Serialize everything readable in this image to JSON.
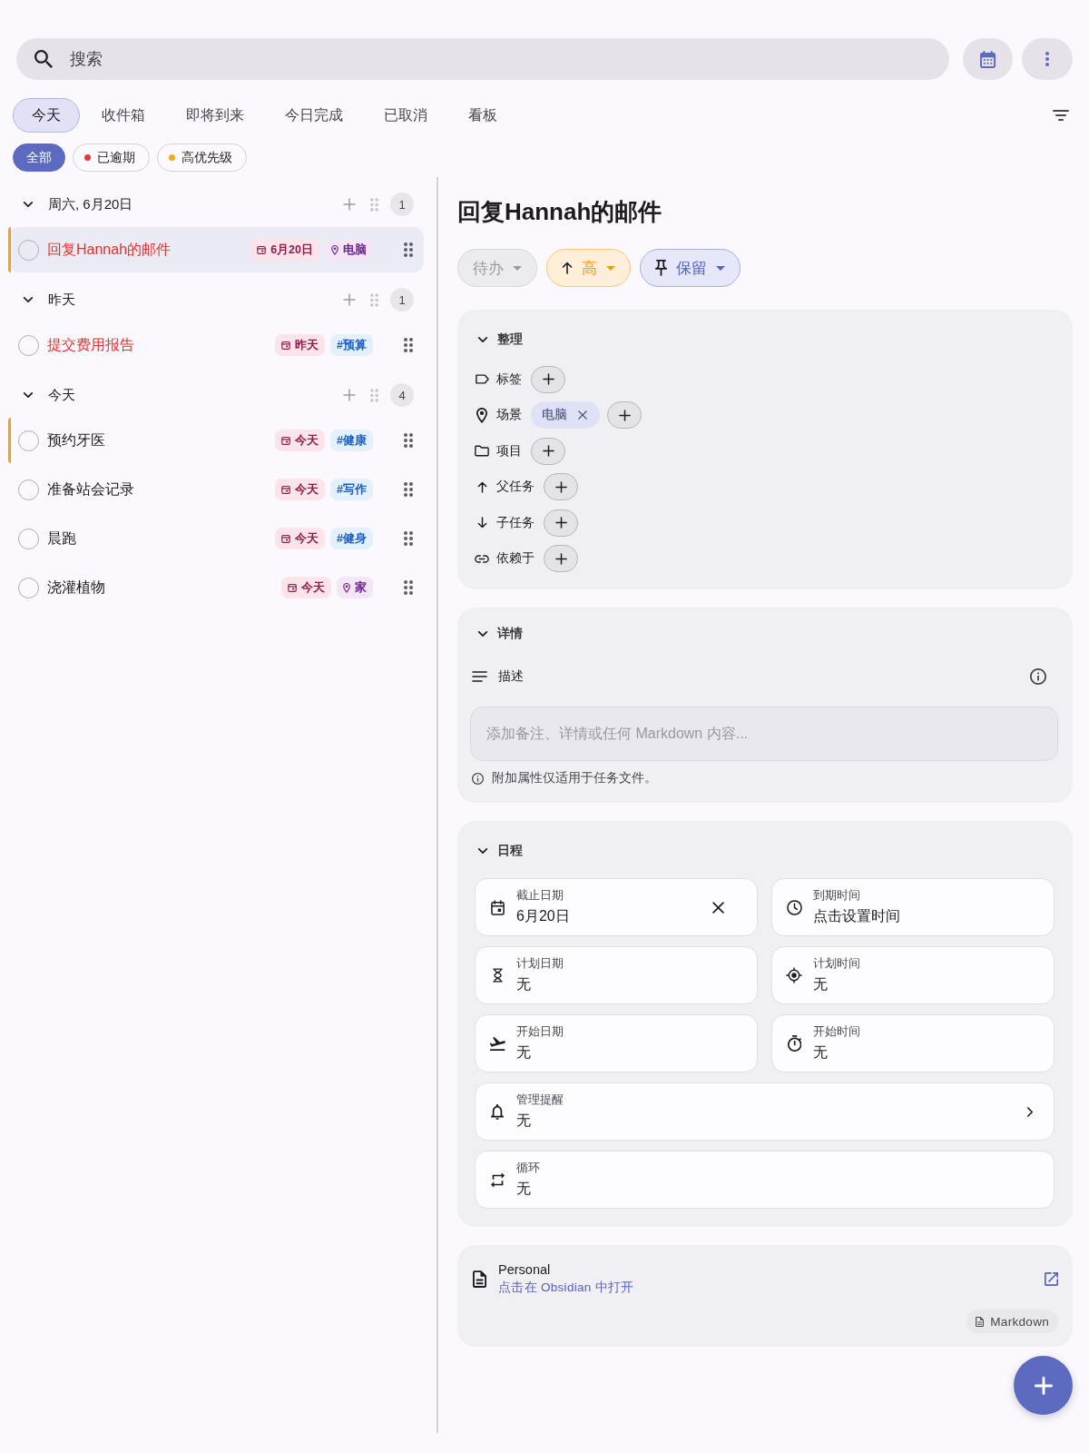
{
  "search": {
    "placeholder": "搜索"
  },
  "tabs": [
    {
      "label": "今天",
      "selected": true
    },
    {
      "label": "收件箱",
      "selected": false
    },
    {
      "label": "即将到来",
      "selected": false
    },
    {
      "label": "今日完成",
      "selected": false
    },
    {
      "label": "已取消",
      "selected": false
    },
    {
      "label": "看板",
      "selected": false
    }
  ],
  "filters": [
    {
      "label": "全部",
      "selected": true
    },
    {
      "label": "已逾期",
      "selected": false,
      "color": "#e53935"
    },
    {
      "label": "高优先级",
      "selected": false,
      "color": "#f9a825"
    }
  ],
  "groups": [
    {
      "title": "周六, 6月20日",
      "expanded": true,
      "count": "1",
      "tasks": [
        {
          "title": "回复Hannah的邮件",
          "checked": false,
          "selected": true,
          "overdue": true,
          "high_priority": true,
          "chips": [
            {
              "kind": "date",
              "label": "6月20日"
            },
            {
              "kind": "context",
              "label": "电脑"
            }
          ]
        }
      ]
    },
    {
      "title": "昨天",
      "expanded": true,
      "count": "1",
      "tasks": [
        {
          "title": "提交费用报告",
          "checked": false,
          "selected": false,
          "overdue": true,
          "high_priority": false,
          "chips": [
            {
              "kind": "date",
              "label": "昨天"
            },
            {
              "kind": "tag",
              "label": "#预算"
            }
          ]
        }
      ]
    },
    {
      "title": "今天",
      "expanded": true,
      "count": "4",
      "tasks": [
        {
          "title": "预约牙医",
          "checked": false,
          "selected": false,
          "overdue": false,
          "high_priority": true,
          "chips": [
            {
              "kind": "date",
              "label": "今天"
            },
            {
              "kind": "tag",
              "label": "#健康"
            }
          ]
        },
        {
          "title": "准备站会记录",
          "checked": false,
          "selected": false,
          "overdue": false,
          "high_priority": false,
          "chips": [
            {
              "kind": "date",
              "label": "今天"
            },
            {
              "kind": "tag",
              "label": "#写作"
            }
          ]
        },
        {
          "title": "晨跑",
          "checked": false,
          "selected": false,
          "overdue": false,
          "high_priority": false,
          "chips": [
            {
              "kind": "date",
              "label": "今天"
            },
            {
              "kind": "tag",
              "label": "#健身"
            }
          ]
        },
        {
          "title": "浇灌植物",
          "checked": false,
          "selected": false,
          "overdue": false,
          "high_priority": false,
          "chips": [
            {
              "kind": "date",
              "label": "今天"
            },
            {
              "kind": "context",
              "label": "家"
            }
          ]
        }
      ]
    }
  ],
  "detail": {
    "title": "回复Hannah的邮件",
    "pills": [
      {
        "kind": "status",
        "label": "待办"
      },
      {
        "kind": "priority",
        "label": "高"
      },
      {
        "kind": "pin",
        "label": "保留"
      }
    ],
    "organize": {
      "title": "整理",
      "expanded": true,
      "rows": [
        {
          "kind": "tags",
          "label": "标签"
        },
        {
          "kind": "contexts",
          "label": "场景",
          "values": [
            "电脑"
          ]
        },
        {
          "kind": "projects",
          "label": "项目"
        },
        {
          "kind": "parent",
          "label": "父任务"
        },
        {
          "kind": "subtasks",
          "label": "子任务"
        },
        {
          "kind": "blocked_by",
          "label": "依赖于"
        }
      ]
    },
    "details": {
      "title": "详情",
      "expanded": true,
      "description_label": "描述",
      "placeholder": "添加备注、详情或任何 Markdown 内容...",
      "note": "附加属性仅适用于任务文件。"
    },
    "schedule": {
      "title": "日程",
      "expanded": true,
      "fields": [
        {
          "kind": "due_date",
          "label": "截止日期",
          "value": "6月20日",
          "clearable": true
        },
        {
          "kind": "due_time",
          "label": "到期时间",
          "value": "点击设置时间",
          "clearable": false
        },
        {
          "kind": "scheduled_date",
          "label": "计划日期",
          "value": "无",
          "clearable": false
        },
        {
          "kind": "scheduled_time",
          "label": "计划时间",
          "value": "无",
          "clearable": false
        },
        {
          "kind": "start_date",
          "label": "开始日期",
          "value": "无",
          "clearable": false
        },
        {
          "kind": "start_time",
          "label": "开始时间",
          "value": "无",
          "clearable": false
        },
        {
          "kind": "reminders",
          "label": "管理提醒",
          "value": "无",
          "clearable": false
        },
        {
          "kind": "recurrence",
          "label": "循环",
          "value": "无",
          "clearable": false
        }
      ]
    },
    "file": {
      "name": "Personal",
      "action": "点击在 Obsidian 中打开",
      "format": "Markdown"
    }
  }
}
